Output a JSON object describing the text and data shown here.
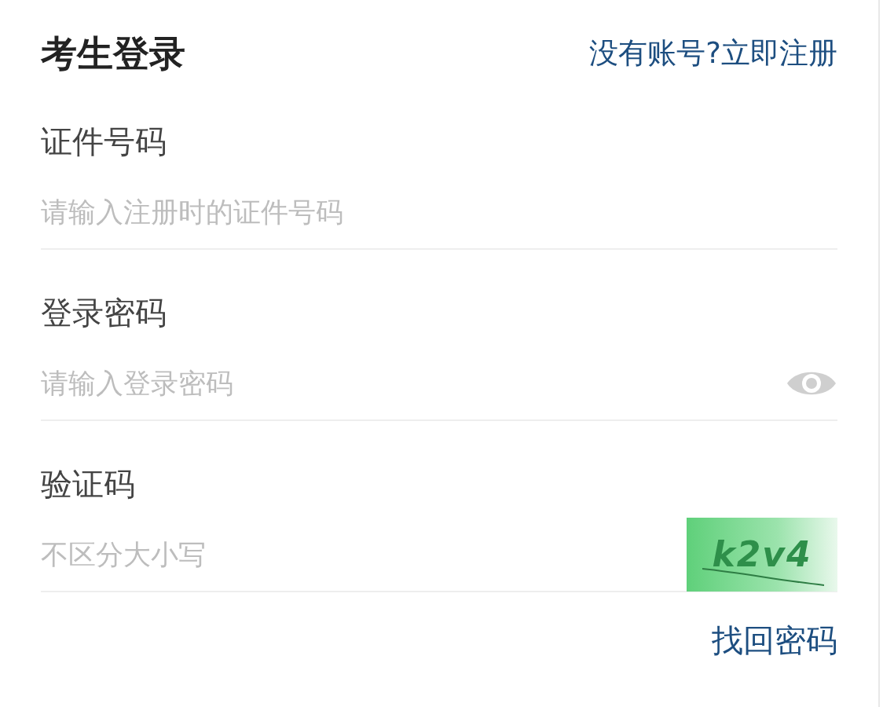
{
  "title": "考生登录",
  "register_link": "没有账号?立即注册",
  "fields": [
    {
      "kind": "text",
      "label": "证件号码",
      "placeholder": "请输入注册时的证件号码"
    },
    {
      "kind": "password",
      "label": "登录密码",
      "placeholder": "请输入登录密码"
    },
    {
      "kind": "captcha",
      "label": "验证码",
      "placeholder": "不区分大小写",
      "captcha": "k2v4"
    }
  ],
  "forgot_link": "找回密码"
}
